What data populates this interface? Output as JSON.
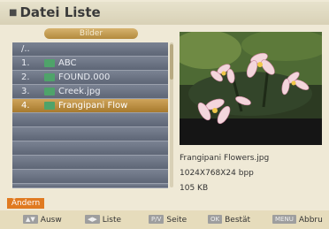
{
  "title": "Datei Liste",
  "folder_label": "Bilder",
  "rows": [
    {
      "num": "/..",
      "name": "",
      "has_icon": false
    },
    {
      "num": "1.",
      "name": "ABC",
      "has_icon": true
    },
    {
      "num": "2.",
      "name": "FOUND.000",
      "has_icon": true
    },
    {
      "num": "3.",
      "name": "Creek.jpg",
      "has_icon": true
    },
    {
      "num": "4.",
      "name": "Frangipani Flow",
      "has_icon": true
    }
  ],
  "selected_index": 4,
  "empty_rows": 6,
  "fileinfo": {
    "name": "Frangipani Flowers.jpg",
    "resolution": "1024X768X24 bpp",
    "size": "105 KB"
  },
  "action_button": "Ändern",
  "hints": [
    {
      "key": "▲▼",
      "label": "Ausw"
    },
    {
      "key": "◀▶",
      "label": "Liste"
    },
    {
      "key": "P/V",
      "label": "Seite"
    },
    {
      "key": "OK",
      "label": "Bestät"
    },
    {
      "key": "MENU",
      "label": "Abbru"
    }
  ],
  "colors": {
    "accent": "#e07a21",
    "selected_row": "#bf9445",
    "row": "#6d7584",
    "background": "#efe9d6"
  },
  "icons": {
    "title": "folder-icon",
    "file": "file-icon"
  }
}
